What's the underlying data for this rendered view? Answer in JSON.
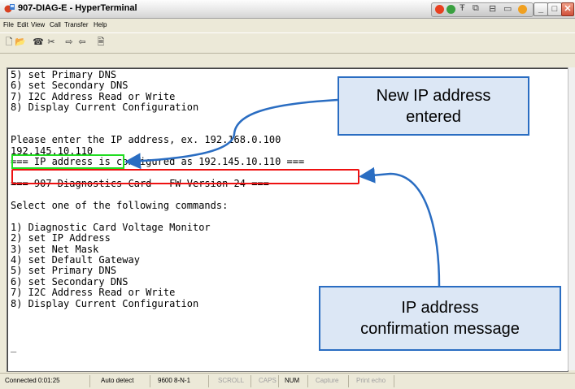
{
  "window": {
    "title": "907-DIAG-E - HyperTerminal",
    "buttons": {
      "minimize": "_",
      "maximize": "□",
      "close": "✕"
    }
  },
  "menubar": [
    "File",
    "Edit",
    "View",
    "Call",
    "Transfer",
    "Help"
  ],
  "toolbar": {
    "icons": [
      "new-icon",
      "open-icon",
      "phone-icon",
      "disconnect-icon",
      "send-icon",
      "receive-icon",
      "properties-icon"
    ],
    "glyphs": [
      "🗋",
      "📂",
      "☎",
      "✂",
      "⇨",
      "⇦",
      "🗎"
    ]
  },
  "terminal": {
    "lines": [
      "5) set Primary DNS",
      "6) set Secondary DNS",
      "7) I2C Address Read or Write",
      "8) Display Current Configuration",
      "",
      "",
      "Please enter the IP address, ex. 192.168.0.100",
      "192.145.10.110",
      "=== IP address is configured as 192.145.10.110 ===",
      "",
      "=== 907 Diagnostics Card - FW Version 24 ===",
      "",
      "Select one of the following commands:",
      "",
      "1) Diagnostic Card Voltage Monitor",
      "2) set IP Address",
      "3) set Net Mask",
      "4) set Default Gateway",
      "5) set Primary DNS",
      "6) set Secondary DNS",
      "7) I2C Address Read or Write",
      "8) Display Current Configuration",
      "",
      "",
      "",
      "_"
    ]
  },
  "callouts": {
    "new_ip": {
      "line1": "New IP address",
      "line2": "entered"
    },
    "confirm": {
      "line1": "IP address",
      "line2": "confirmation message"
    }
  },
  "status": {
    "connected": "Connected 0:01:25",
    "detect": "Auto detect",
    "params": "9600 8-N-1",
    "scroll": "SCROLL",
    "caps": "CAPS",
    "num": "NUM",
    "capture": "Capture",
    "echo": "Print echo"
  },
  "colors": {
    "highlight_green": "#22dd22",
    "highlight_red": "#ee1111",
    "callout_border": "#2a6dc2",
    "callout_fill": "#dce7f5"
  }
}
